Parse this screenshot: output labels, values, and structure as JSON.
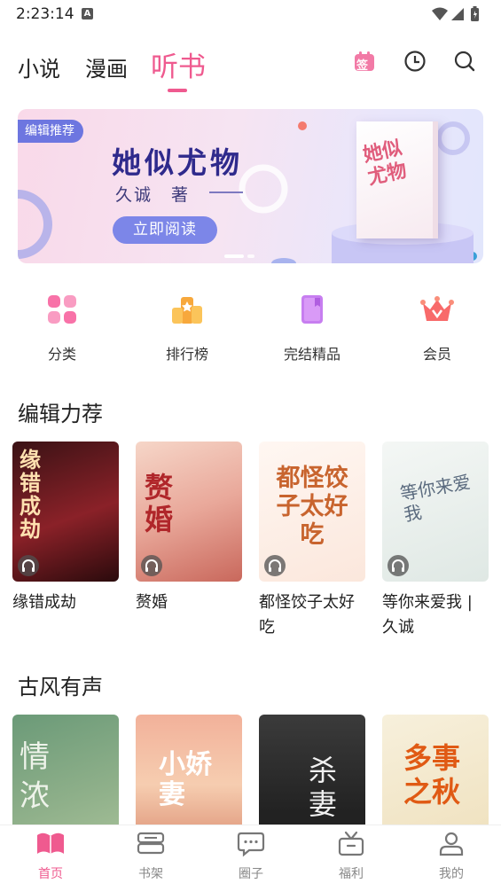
{
  "status_bar": {
    "time": "2:23:14",
    "notification_badge": "A"
  },
  "top_nav": {
    "tabs": [
      "小说",
      "漫画",
      "听书"
    ],
    "active_tab": "听书",
    "accent_color": "#ef5a8f",
    "checkin_icon_label": "签"
  },
  "banner": {
    "badge": "编辑推荐",
    "title": "她似尤物",
    "author": "久诚　著",
    "read_button": "立即阅读",
    "cover_text": "她似尤物",
    "slide_count": 2,
    "active_slide": 1
  },
  "quick_links": [
    {
      "label": "分类",
      "icon": "category-icon"
    },
    {
      "label": "排行榜",
      "icon": "ranking-icon"
    },
    {
      "label": "完结精品",
      "icon": "book-icon"
    },
    {
      "label": "会员",
      "icon": "vip-crown-icon"
    }
  ],
  "sections": [
    {
      "title": "编辑力荐",
      "books": [
        {
          "title": "缘错成劫",
          "cover_text": "缘错成劫"
        },
        {
          "title": "赘婚",
          "cover_text": "赘婚"
        },
        {
          "title": "都怪饺子太好吃",
          "cover_text": "都怪饺子太好吃"
        },
        {
          "title": "等你来爱我 | 久诚",
          "cover_text": "等你来爱我"
        }
      ]
    },
    {
      "title": "古风有声",
      "books": [
        {
          "cover_text": "情浓"
        },
        {
          "cover_text": "小娇妻"
        },
        {
          "cover_text": "杀妻"
        },
        {
          "cover_text": "多事之秋"
        }
      ]
    }
  ],
  "bottom_tabs": [
    {
      "label": "首页",
      "icon": "home-icon",
      "active": true
    },
    {
      "label": "书架",
      "icon": "bookshelf-icon",
      "active": false
    },
    {
      "label": "圈子",
      "icon": "chat-bubble-icon",
      "active": false
    },
    {
      "label": "福利",
      "icon": "gift-icon",
      "active": false
    },
    {
      "label": "我的",
      "icon": "profile-icon",
      "active": false
    }
  ]
}
